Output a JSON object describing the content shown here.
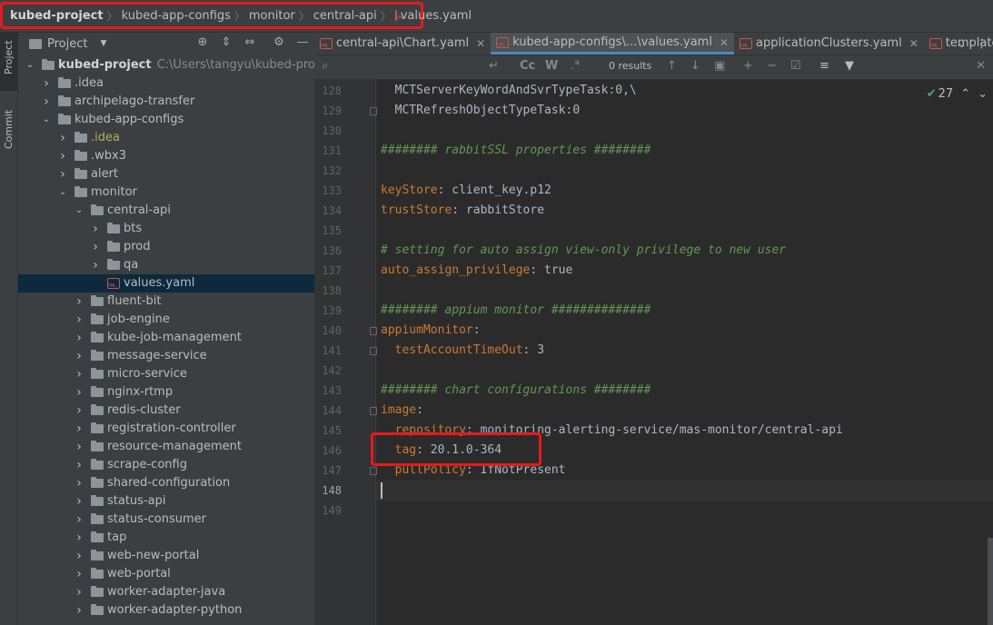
{
  "breadcrumb": {
    "items": [
      "kubed-project",
      "kubed-app-configs",
      "monitor",
      "central-api"
    ],
    "file": "values.yaml"
  },
  "left_strip": {
    "project": "Project",
    "commit": "Commit"
  },
  "project_pane": {
    "title": "Project",
    "root_name": "kubed-project",
    "root_path": "C:\\Users\\tangyu\\kubed-project",
    "items": [
      {
        "label": ".idea",
        "depth": 1,
        "expanded": false,
        "kind": "folder"
      },
      {
        "label": "archipelago-transfer",
        "depth": 1,
        "expanded": false,
        "kind": "folder"
      },
      {
        "label": "kubed-app-configs",
        "depth": 1,
        "expanded": true,
        "kind": "folder"
      },
      {
        "label": ".idea",
        "depth": 2,
        "expanded": false,
        "kind": "folder",
        "special": "idea"
      },
      {
        "label": ".wbx3",
        "depth": 2,
        "expanded": false,
        "kind": "folder"
      },
      {
        "label": "alert",
        "depth": 2,
        "expanded": false,
        "kind": "folder"
      },
      {
        "label": "monitor",
        "depth": 2,
        "expanded": true,
        "kind": "folder"
      },
      {
        "label": "central-api",
        "depth": 3,
        "expanded": true,
        "kind": "folder"
      },
      {
        "label": "bts",
        "depth": 4,
        "expanded": false,
        "kind": "folder"
      },
      {
        "label": "prod",
        "depth": 4,
        "expanded": false,
        "kind": "folder"
      },
      {
        "label": "qa",
        "depth": 4,
        "expanded": false,
        "kind": "folder"
      },
      {
        "label": "values.yaml",
        "depth": 4,
        "kind": "file",
        "selected": true
      },
      {
        "label": "fluent-bit",
        "depth": 3,
        "expanded": false,
        "kind": "folder"
      },
      {
        "label": "job-engine",
        "depth": 3,
        "expanded": false,
        "kind": "folder"
      },
      {
        "label": "kube-job-management",
        "depth": 3,
        "expanded": false,
        "kind": "folder"
      },
      {
        "label": "message-service",
        "depth": 3,
        "expanded": false,
        "kind": "folder"
      },
      {
        "label": "micro-service",
        "depth": 3,
        "expanded": false,
        "kind": "folder"
      },
      {
        "label": "nginx-rtmp",
        "depth": 3,
        "expanded": false,
        "kind": "folder"
      },
      {
        "label": "redis-cluster",
        "depth": 3,
        "expanded": false,
        "kind": "folder"
      },
      {
        "label": "registration-controller",
        "depth": 3,
        "expanded": false,
        "kind": "folder"
      },
      {
        "label": "resource-management",
        "depth": 3,
        "expanded": false,
        "kind": "folder"
      },
      {
        "label": "scrape-config",
        "depth": 3,
        "expanded": false,
        "kind": "folder"
      },
      {
        "label": "shared-configuration",
        "depth": 3,
        "expanded": false,
        "kind": "folder"
      },
      {
        "label": "status-api",
        "depth": 3,
        "expanded": false,
        "kind": "folder"
      },
      {
        "label": "status-consumer",
        "depth": 3,
        "expanded": false,
        "kind": "folder"
      },
      {
        "label": "tap",
        "depth": 3,
        "expanded": false,
        "kind": "folder"
      },
      {
        "label": "web-new-portal",
        "depth": 3,
        "expanded": false,
        "kind": "folder"
      },
      {
        "label": "web-portal",
        "depth": 3,
        "expanded": false,
        "kind": "folder"
      },
      {
        "label": "worker-adapter-java",
        "depth": 3,
        "expanded": false,
        "kind": "folder"
      },
      {
        "label": "worker-adapter-python",
        "depth": 3,
        "expanded": false,
        "kind": "folder"
      }
    ]
  },
  "editor_tabs": [
    {
      "label": "central-api\\Chart.yaml",
      "active": false,
      "closable": true
    },
    {
      "label": "kubed-app-configs\\...\\values.yaml",
      "active": true,
      "closable": true
    },
    {
      "label": "applicationClusters.yaml",
      "active": false,
      "closable": true
    },
    {
      "label": "templates\\",
      "active": false,
      "closable": false
    }
  ],
  "find_bar": {
    "results": "0 results",
    "cc": "Cc",
    "w": "W",
    "regex": ".*"
  },
  "inspection": {
    "count": "27"
  },
  "code_lines": [
    {
      "n": "128",
      "tokens": [
        {
          "t": "  MCTServerKeyWordAndSvrTypeTask:0,\\",
          "c": "v"
        }
      ]
    },
    {
      "n": "129",
      "tokens": [
        {
          "t": "  MCTRefreshObjectTypeTask:0",
          "c": "v"
        }
      ]
    },
    {
      "n": "130",
      "tokens": []
    },
    {
      "n": "131",
      "tokens": [
        {
          "t": "######## rabbitSSL properties ########",
          "c": "c"
        }
      ]
    },
    {
      "n": "132",
      "tokens": []
    },
    {
      "n": "133",
      "tokens": [
        {
          "t": "keyStore",
          "c": "k"
        },
        {
          "t": ": client_key.p12",
          "c": "v"
        }
      ]
    },
    {
      "n": "134",
      "tokens": [
        {
          "t": "trustStore",
          "c": "k"
        },
        {
          "t": ": rabbitStore",
          "c": "v"
        }
      ]
    },
    {
      "n": "135",
      "tokens": []
    },
    {
      "n": "136",
      "tokens": [
        {
          "t": "# setting for auto assign view-only privilege to new user",
          "c": "c"
        }
      ]
    },
    {
      "n": "137",
      "tokens": [
        {
          "t": "auto_assign_privilege",
          "c": "k"
        },
        {
          "t": ": true",
          "c": "v"
        }
      ]
    },
    {
      "n": "138",
      "tokens": []
    },
    {
      "n": "139",
      "tokens": [
        {
          "t": "######## appium monitor ##############",
          "c": "c"
        }
      ]
    },
    {
      "n": "140",
      "tokens": [
        {
          "t": "appiumMonitor",
          "c": "k"
        },
        {
          "t": ":",
          "c": "v"
        }
      ]
    },
    {
      "n": "141",
      "tokens": [
        {
          "t": "  testAccountTimeOut",
          "c": "k"
        },
        {
          "t": ": 3",
          "c": "v"
        }
      ]
    },
    {
      "n": "142",
      "tokens": []
    },
    {
      "n": "143",
      "tokens": [
        {
          "t": "######## chart configurations ########",
          "c": "c"
        }
      ]
    },
    {
      "n": "144",
      "tokens": [
        {
          "t": "image",
          "c": "k"
        },
        {
          "t": ":",
          "c": "v"
        }
      ]
    },
    {
      "n": "145",
      "tokens": [
        {
          "t": "  repository",
          "c": "k"
        },
        {
          "t": ": monitoring-alerting-service/mas-monitor/central-api",
          "c": "v"
        }
      ]
    },
    {
      "n": "146",
      "tokens": [
        {
          "t": "  tag",
          "c": "k"
        },
        {
          "t": ": 20.1.0-364",
          "c": "v"
        }
      ]
    },
    {
      "n": "147",
      "tokens": [
        {
          "t": "  pullPolicy",
          "c": "k"
        },
        {
          "t": ": IfNotPresent",
          "c": "v"
        }
      ]
    },
    {
      "n": "148",
      "tokens": []
    },
    {
      "n": "149",
      "tokens": []
    }
  ],
  "current_line": "148",
  "highlight_line": "146",
  "fold_lines": [
    "129",
    "140",
    "141",
    "144",
    "147"
  ]
}
